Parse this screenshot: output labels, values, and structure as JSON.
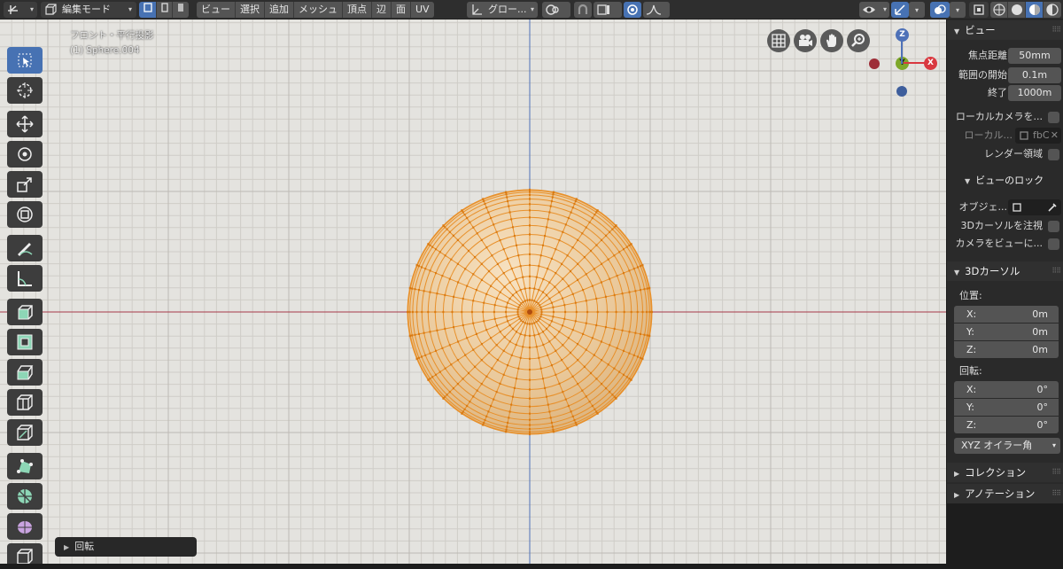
{
  "header": {
    "mode": "編集モード",
    "menus": [
      "ビュー",
      "選択",
      "追加",
      "メッシュ",
      "頂点",
      "辺",
      "面",
      "UV"
    ],
    "transform_orientation": "グロー..."
  },
  "viewport": {
    "view_name": "フロント・平行投影",
    "object_name": "(1) Sphere.004",
    "gizmo_axes": {
      "z": "Z",
      "y": "Y",
      "x": "X"
    },
    "colors": {
      "x_axis": "#a63a48",
      "z_axis": "#4e71b8",
      "active": "#4772b3",
      "mesh_edge": "#e8902a",
      "mesh_face": "#e9c89a"
    }
  },
  "toolbar": {
    "tools": [
      "select-box-icon",
      "cursor-icon",
      "move-icon",
      "rotate-icon",
      "scale-icon",
      "transform-icon",
      "annotate-icon",
      "measure-icon",
      "extrude-icon",
      "inset-icon",
      "bevel-icon",
      "loop-cut-icon",
      "knife-icon",
      "poly-build-icon",
      "spin-icon",
      "smooth-icon",
      "shear-icon"
    ]
  },
  "sidebar": {
    "view_panel": {
      "title": "ビュー",
      "focal_length_label": "焦点距離",
      "focal_length_value": "50mm",
      "clip_start_label": "範囲の開始",
      "clip_start_value": "0.1m",
      "clip_end_label": "終了",
      "clip_end_value": "1000m",
      "local_camera_label": "ローカルカメラを...",
      "local_label": "ローカル...",
      "local_field": "fbC",
      "render_region_label": "レンダー領域"
    },
    "view_lock": {
      "title": "ビューのロック",
      "object_label": "オブジェ...",
      "cursor_lock_label": "3Dカーソルを注視",
      "camera_to_view_label": "カメラをビューに..."
    },
    "cursor_panel": {
      "title": "3Dカーソル",
      "location_label": "位置:",
      "x_label": "X:",
      "x_value": "0m",
      "y_label": "Y:",
      "y_value": "0m",
      "z_label": "Z:",
      "z_value": "0m",
      "rotation_label": "回転:",
      "rx_label": "X:",
      "rx_value": "0°",
      "ry_label": "Y:",
      "ry_value": "0°",
      "rz_label": "Z:",
      "rz_value": "0°",
      "rotation_mode": "XYZ オイラー角"
    },
    "collection_title": "コレクション",
    "annotation_title": "アノテーション"
  },
  "redo_panel": {
    "label": "回転"
  }
}
